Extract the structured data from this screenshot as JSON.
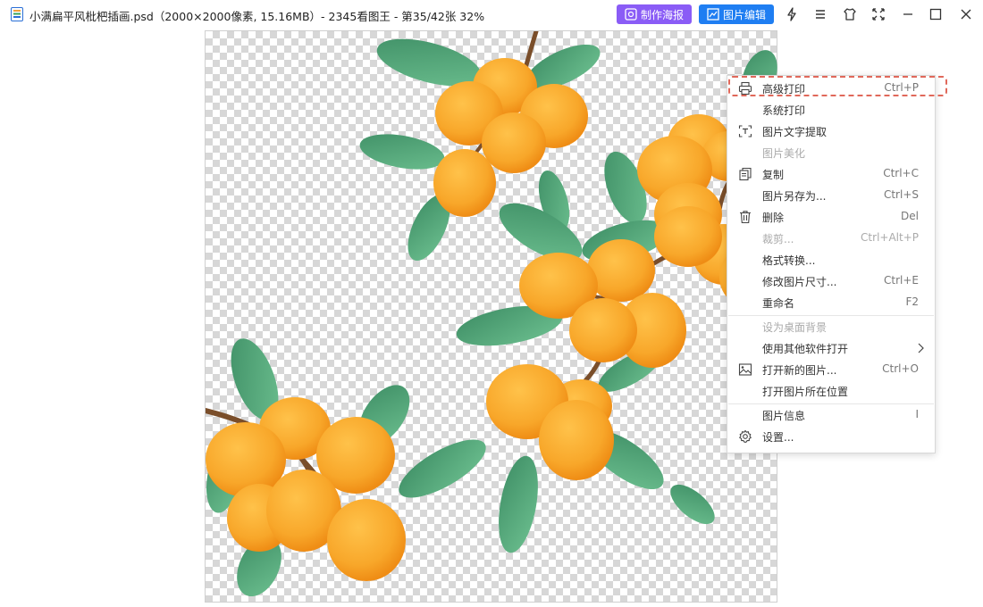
{
  "window": {
    "title": "小满扁平风枇杷插画.psd（2000×2000像素, 15.16MB）- 2345看图王 - 第35/42张 32%",
    "poster_button": "制作海报",
    "edit_button": "图片编辑"
  },
  "context_menu": {
    "items": [
      {
        "label": "高级打印",
        "shortcut": "Ctrl+P",
        "icon": "printer-icon",
        "disabled": false
      },
      {
        "label": "系统打印",
        "shortcut": "",
        "icon": "",
        "disabled": false
      },
      {
        "label": "图片文字提取",
        "shortcut": "",
        "icon": "text-scan-icon",
        "disabled": false
      },
      {
        "label": "图片美化",
        "shortcut": "",
        "icon": "",
        "disabled": true
      },
      {
        "label": "复制",
        "shortcut": "Ctrl+C",
        "icon": "copy-icon",
        "disabled": false
      },
      {
        "label": "图片另存为...",
        "shortcut": "Ctrl+S",
        "icon": "",
        "disabled": false
      },
      {
        "label": "删除",
        "shortcut": "Del",
        "icon": "trash-icon",
        "disabled": false
      },
      {
        "label": "裁剪...",
        "shortcut": "Ctrl+Alt+P",
        "icon": "",
        "disabled": true
      },
      {
        "label": "格式转换...",
        "shortcut": "",
        "icon": "",
        "disabled": false
      },
      {
        "label": "修改图片尺寸...",
        "shortcut": "Ctrl+E",
        "icon": "",
        "disabled": false
      },
      {
        "label": "重命名",
        "shortcut": "F2",
        "icon": "",
        "disabled": false
      },
      {
        "label": "设为桌面背景",
        "shortcut": "",
        "icon": "",
        "disabled": true
      },
      {
        "label": "使用其他软件打开",
        "shortcut": "",
        "icon": "",
        "disabled": false
      },
      {
        "label": "打开新的图片...",
        "shortcut": "Ctrl+O",
        "icon": "image-icon",
        "disabled": false
      },
      {
        "label": "打开图片所在位置",
        "shortcut": "",
        "icon": "",
        "disabled": false
      },
      {
        "label": "图片信息",
        "shortcut": "I",
        "icon": "",
        "disabled": false
      },
      {
        "label": "设置...",
        "shortcut": "",
        "icon": "gear-icon",
        "disabled": false
      }
    ]
  },
  "colors": {
    "poster_button": "#8a5cf6",
    "edit_button": "#1f7ef2",
    "highlight": "#e0685a",
    "fruit": "#f9a825",
    "leaf": "#4e9e72",
    "branch": "#7a4e2a"
  }
}
